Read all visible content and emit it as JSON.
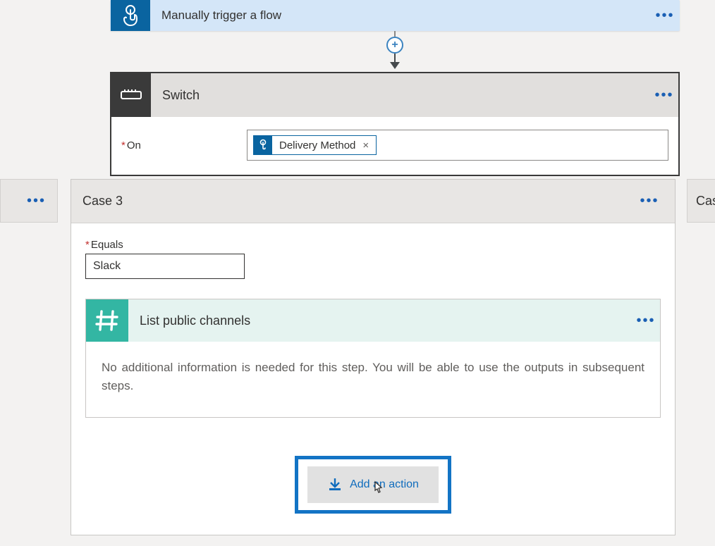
{
  "trigger": {
    "title": "Manually trigger a flow",
    "icon": "touch-icon"
  },
  "switch": {
    "title": "Switch",
    "on_label": "On",
    "token": {
      "label": "Delivery Method",
      "icon": "touch-icon"
    }
  },
  "case_peek_left": {
    "menu": "•••"
  },
  "case_peek_right": {
    "title_fragment": "Cas"
  },
  "case3": {
    "title": "Case 3",
    "equals_label": "Equals",
    "equals_value": "Slack",
    "action": {
      "title": "List public channels",
      "icon": "slack-hash-icon",
      "body": "No additional information is needed for this step. You will be able to use the outputs in subsequent steps."
    },
    "add_action_label": "Add an action"
  },
  "menu_dots": "•••",
  "colors": {
    "accent_blue": "#0f6cbd",
    "trigger_blue": "#0a64a0",
    "slack_green": "#33b6a3",
    "highlight_blue": "#1374c5"
  }
}
